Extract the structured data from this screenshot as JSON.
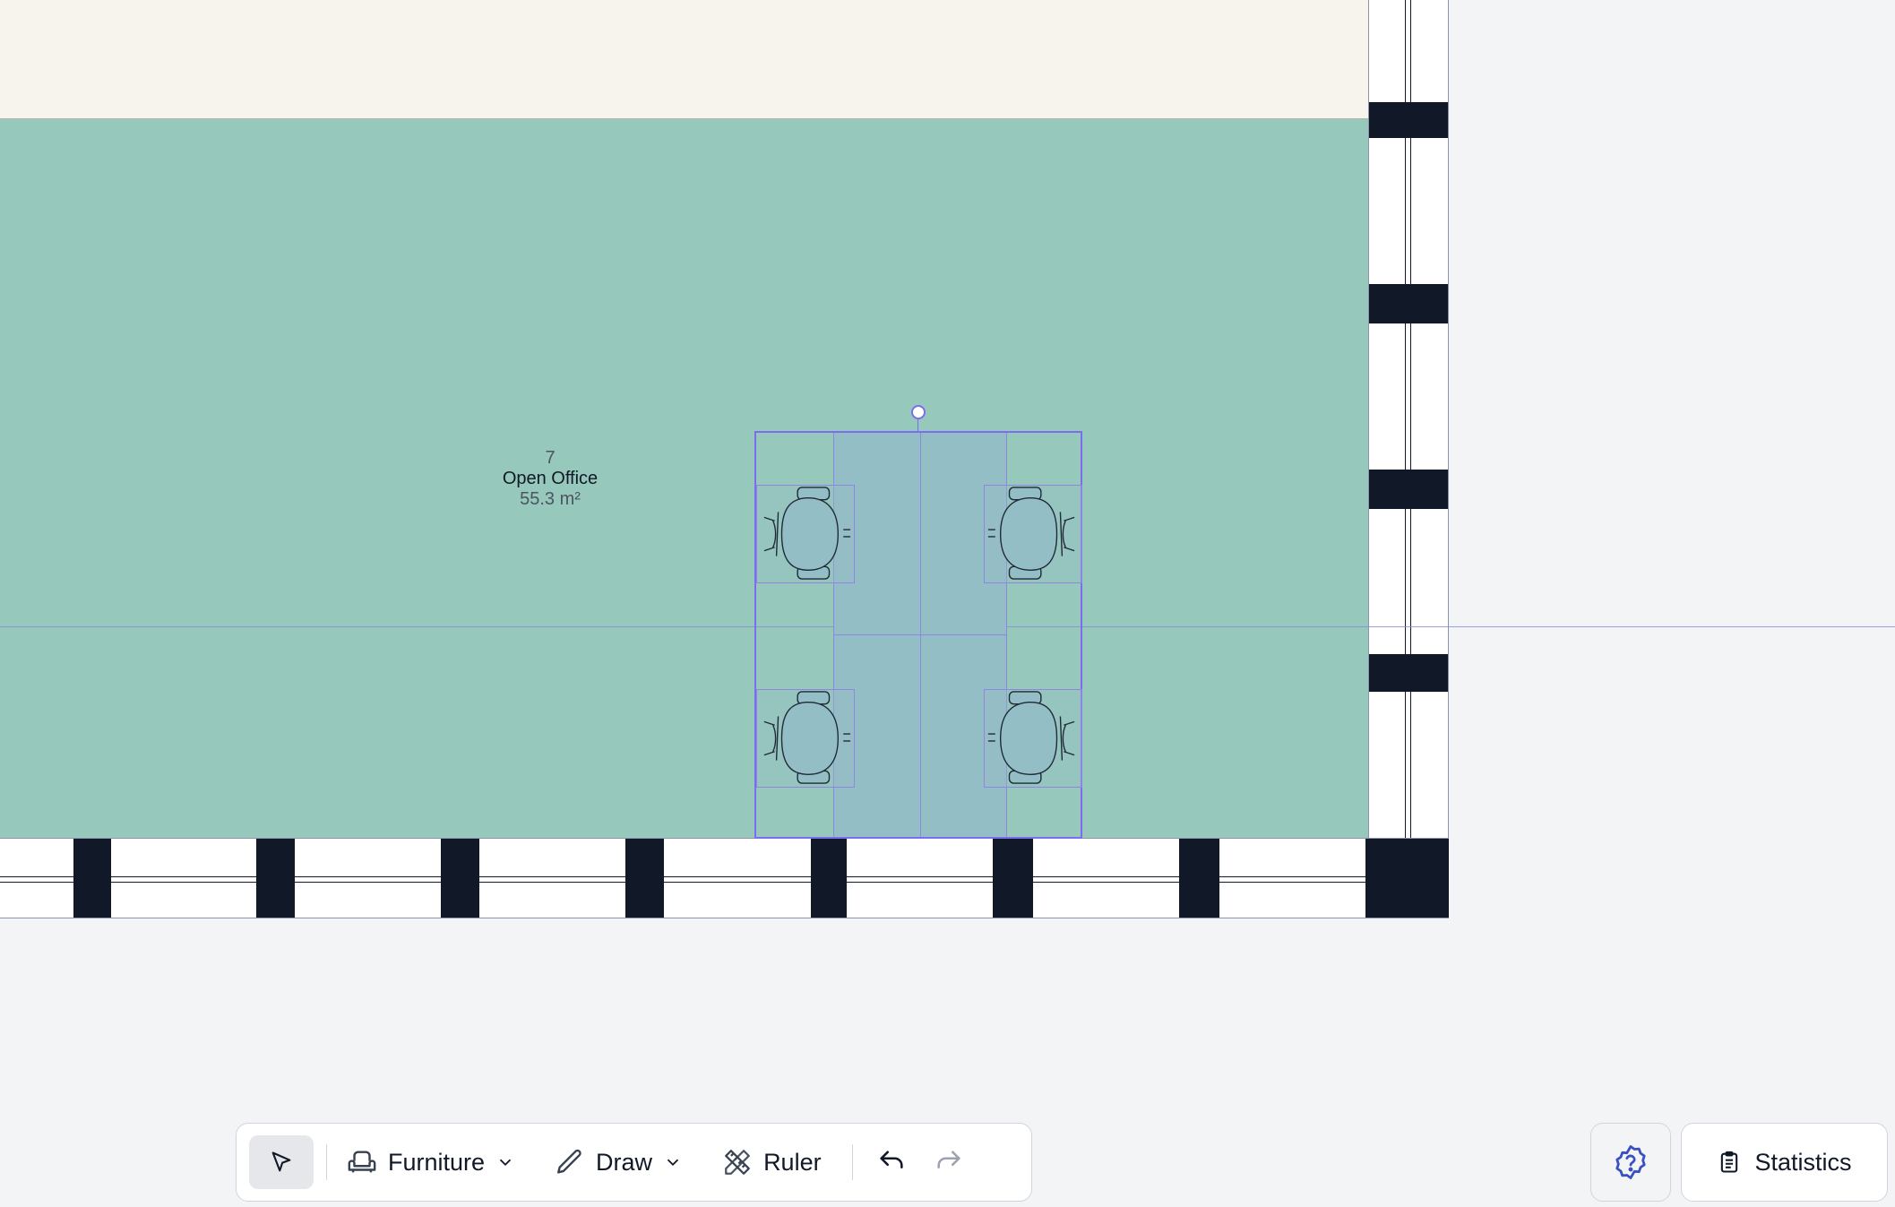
{
  "room": {
    "number": "7",
    "name": "Open Office",
    "area": "55.3 m²",
    "fill_color": "#97c8bc"
  },
  "desk_group": {
    "chair_count": 4,
    "selection_color": "#7c6cf0"
  },
  "toolbar": {
    "furniture_label": "Furniture",
    "draw_label": "Draw",
    "ruler_label": "Ruler",
    "icons": {
      "select": "cursor-arrow-icon",
      "furniture": "armchair-icon",
      "draw": "pencil-icon",
      "ruler": "ruler-pencil-icon",
      "undo": "undo-icon",
      "redo": "redo-icon"
    }
  },
  "help": {
    "icon": "help-badge-icon",
    "color": "#3b4fc4"
  },
  "statistics": {
    "label": "Statistics",
    "icon": "clipboard-icon"
  }
}
